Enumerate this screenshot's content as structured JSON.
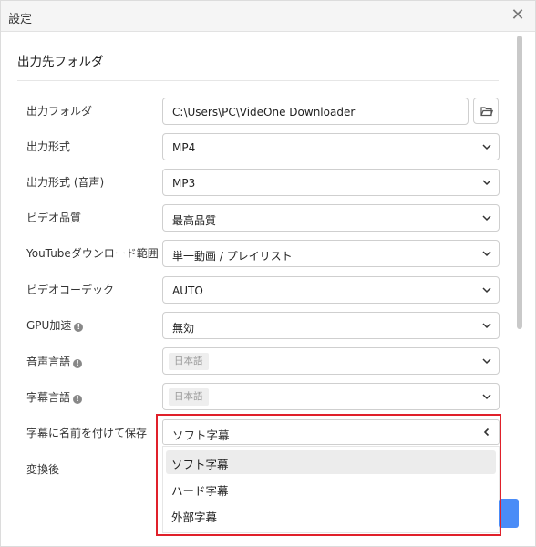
{
  "window": {
    "title": "設定",
    "close_glyph": "✕"
  },
  "section": {
    "title": "出力先フォルダ"
  },
  "rows": {
    "output_folder": {
      "label": "出力フォルダ",
      "value": "C:\\Users\\PC\\VideOne Downloader"
    },
    "output_format": {
      "label": "出力形式",
      "value": "MP4"
    },
    "output_format_audio": {
      "label": "出力形式 (音声)",
      "value": "MP3"
    },
    "video_quality": {
      "label": "ビデオ品質",
      "value": "最高品質"
    },
    "youtube_range": {
      "label": "YouTubeダウンロード範囲",
      "value": "単一動画 / プレイリスト"
    },
    "video_codec": {
      "label": "ビデオコーデック",
      "value": "AUTO"
    },
    "gpu_accel": {
      "label": "GPU加速",
      "value": "無効"
    },
    "audio_language": {
      "label": "音声言語",
      "value": "日本語"
    },
    "subtitle_language": {
      "label": "字幕言語",
      "value": "日本語"
    },
    "save_subtitle_name": {
      "label": "字幕に名前を付けて保存",
      "value": "ソフト字幕"
    },
    "after_convert": {
      "label": "変換後"
    }
  },
  "dropdown": {
    "options": [
      "ソフト字幕",
      "ハード字幕",
      "外部字幕"
    ],
    "selected_index": 0
  },
  "colors": {
    "highlight": "#e0202a",
    "accent": "#4a8cf7"
  }
}
